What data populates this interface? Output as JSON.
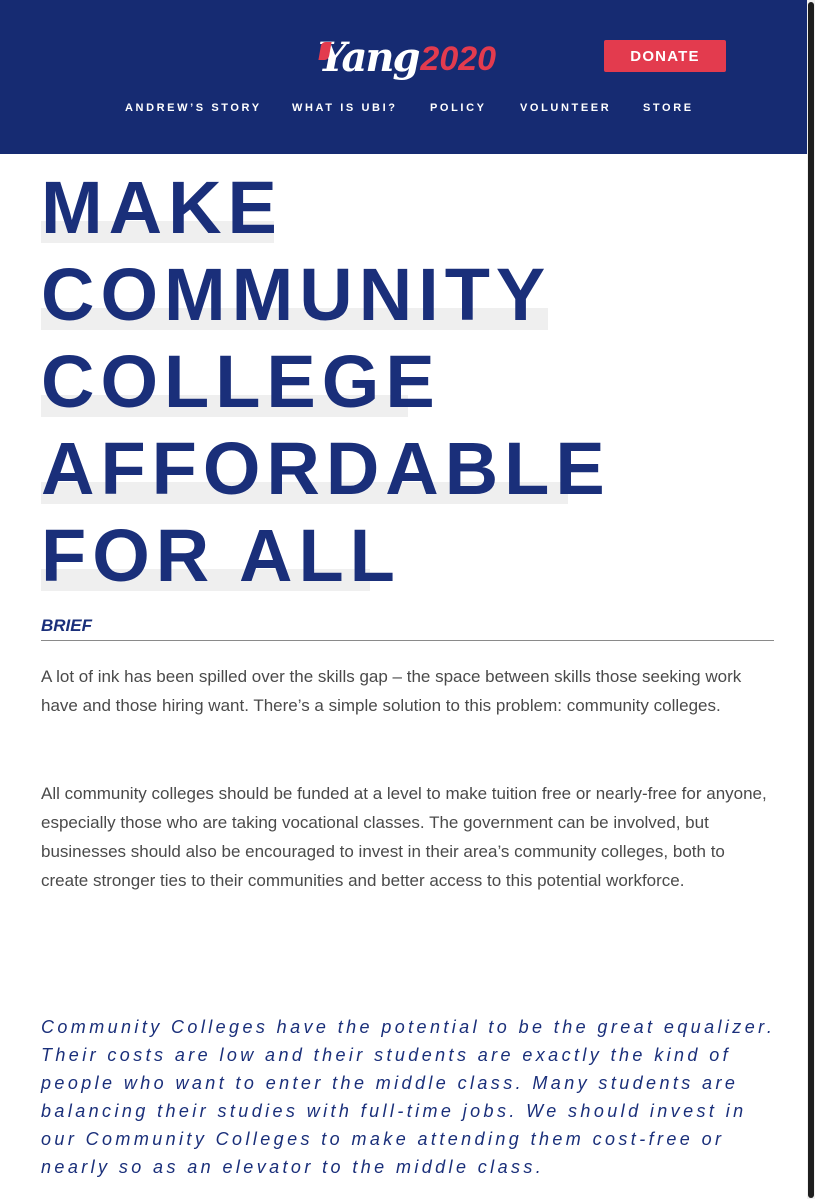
{
  "header": {
    "logo_name": "Yang",
    "logo_year": "2020",
    "donate_label": "DONATE",
    "nav": [
      {
        "label": "ANDREW’S STORY"
      },
      {
        "label": "WHAT IS UBI?"
      },
      {
        "label": "POLICY"
      },
      {
        "label": "VOLUNTEER"
      },
      {
        "label": "STORE"
      }
    ]
  },
  "main": {
    "title_lines": [
      "MAKE",
      "COMMUNITY",
      "COLLEGE",
      "AFFORDABLE",
      "FOR ALL"
    ],
    "brief_label": "BRIEF",
    "paragraphs": [
      "A lot of ink has been spilled over the skills gap – the space between skills those seeking work have and those hiring want. There’s a simple solution to this problem: community colleges.",
      "All community colleges should be funded at a level to make tuition free or nearly-free for anyone, especially those who are taking vocational classes. The government can be involved, but businesses should also be encouraged to invest in their area’s community colleges, both to create stronger ties to their communities and better access to this potential workforce."
    ],
    "quote": "Community Colleges have the potential to be the great equalizer. Their costs are low and their students are exactly the kind of people who want to enter the middle class. Many students are balancing their studies with full-time jobs. We should invest in our Community Colleges to make attending them cost-free or nearly so as an elevator to the middle class."
  },
  "colors": {
    "navy": "#162b72",
    "title_blue": "#1a2f7a",
    "accent_red": "#e33b4e",
    "body_text": "#4a4a4a"
  }
}
